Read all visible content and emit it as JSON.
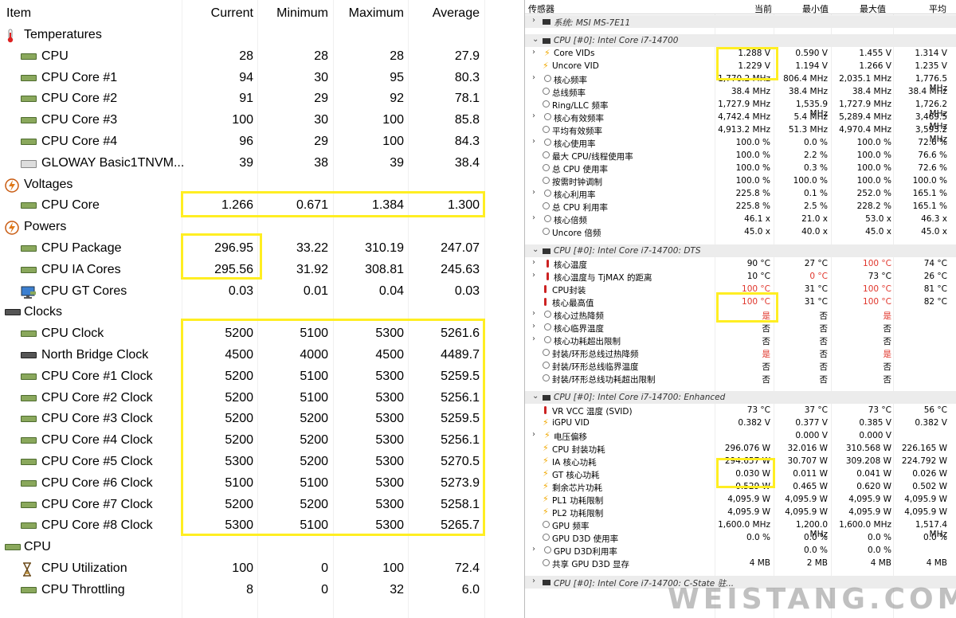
{
  "left": {
    "headers": {
      "item": "Item",
      "current": "Current",
      "minimum": "Minimum",
      "maximum": "Maximum",
      "average": "Average"
    },
    "rows": [
      {
        "kind": "group",
        "icon": "thermometer-icon",
        "name": "Temperatures"
      },
      {
        "kind": "item",
        "icon": "chip",
        "name": "CPU",
        "v": [
          "28",
          "28",
          "28",
          "27.9"
        ]
      },
      {
        "kind": "item",
        "icon": "chip",
        "name": "CPU Core #1",
        "v": [
          "94",
          "30",
          "95",
          "80.3"
        ]
      },
      {
        "kind": "item",
        "icon": "chip",
        "name": "CPU Core #2",
        "v": [
          "91",
          "29",
          "92",
          "78.1"
        ]
      },
      {
        "kind": "item",
        "icon": "chip",
        "name": "CPU Core #3",
        "v": [
          "100",
          "30",
          "100",
          "85.8"
        ]
      },
      {
        "kind": "item",
        "icon": "chip",
        "name": "CPU Core #4",
        "v": [
          "96",
          "29",
          "100",
          "84.3"
        ]
      },
      {
        "kind": "item",
        "icon": "disk",
        "name": "GLOWAY Basic1TNVM...",
        "v": [
          "39",
          "38",
          "39",
          "38.4"
        ]
      },
      {
        "kind": "group",
        "icon": "lightning-icon",
        "name": "Voltages"
      },
      {
        "kind": "item",
        "icon": "chip",
        "name": "CPU Core",
        "v": [
          "1.266",
          "0.671",
          "1.384",
          "1.300"
        ]
      },
      {
        "kind": "group",
        "icon": "lightning-icon",
        "name": "Powers"
      },
      {
        "kind": "item",
        "icon": "chip",
        "name": "CPU Package",
        "v": [
          "296.95",
          "33.22",
          "310.19",
          "247.07"
        ]
      },
      {
        "kind": "item",
        "icon": "chip",
        "name": "CPU IA Cores",
        "v": [
          "295.56",
          "31.92",
          "308.81",
          "245.63"
        ]
      },
      {
        "kind": "item",
        "icon": "monitor",
        "name": "CPU GT Cores",
        "v": [
          "0.03",
          "0.01",
          "0.04",
          "0.03"
        ]
      },
      {
        "kind": "group",
        "icon": "dark-chip",
        "name": "Clocks"
      },
      {
        "kind": "item",
        "icon": "chip",
        "name": "CPU Clock",
        "v": [
          "5200",
          "5100",
          "5300",
          "5261.6"
        ]
      },
      {
        "kind": "item",
        "icon": "dark-chip",
        "name": "North Bridge Clock",
        "v": [
          "4500",
          "4000",
          "4500",
          "4489.7"
        ]
      },
      {
        "kind": "item",
        "icon": "chip",
        "name": "CPU Core #1 Clock",
        "v": [
          "5200",
          "5100",
          "5300",
          "5259.5"
        ]
      },
      {
        "kind": "item",
        "icon": "chip",
        "name": "CPU Core #2 Clock",
        "v": [
          "5200",
          "5100",
          "5300",
          "5256.1"
        ]
      },
      {
        "kind": "item",
        "icon": "chip",
        "name": "CPU Core #3 Clock",
        "v": [
          "5200",
          "5200",
          "5300",
          "5259.5"
        ]
      },
      {
        "kind": "item",
        "icon": "chip",
        "name": "CPU Core #4 Clock",
        "v": [
          "5200",
          "5200",
          "5300",
          "5256.1"
        ]
      },
      {
        "kind": "item",
        "icon": "chip",
        "name": "CPU Core #5 Clock",
        "v": [
          "5300",
          "5200",
          "5300",
          "5270.5"
        ]
      },
      {
        "kind": "item",
        "icon": "chip",
        "name": "CPU Core #6 Clock",
        "v": [
          "5100",
          "5100",
          "5300",
          "5273.9"
        ]
      },
      {
        "kind": "item",
        "icon": "chip",
        "name": "CPU Core #7 Clock",
        "v": [
          "5200",
          "5200",
          "5300",
          "5258.1"
        ]
      },
      {
        "kind": "item",
        "icon": "chip",
        "name": "CPU Core #8 Clock",
        "v": [
          "5300",
          "5100",
          "5300",
          "5265.7"
        ]
      },
      {
        "kind": "group",
        "icon": "chip",
        "name": "CPU"
      },
      {
        "kind": "item",
        "icon": "hourglass-icon",
        "name": "CPU Utilization",
        "v": [
          "100",
          "0",
          "100",
          "72.4"
        ]
      },
      {
        "kind": "item",
        "icon": "chip",
        "name": "CPU Throttling",
        "v": [
          "8",
          "0",
          "32",
          "6.0"
        ]
      }
    ]
  },
  "right": {
    "headers": {
      "sensor": "传感器",
      "current": "当前",
      "min": "最小值",
      "max": "最大值",
      "avg": "平均"
    },
    "sections": [
      {
        "title": "系统: MSI MS-7E11",
        "rows": []
      },
      {
        "title": "CPU [#0]: Intel Core i7-14700",
        "rows": [
          {
            "a": ">",
            "i": "bolt",
            "n": "Core VIDs",
            "v": [
              "1.288 V",
              "0.590 V",
              "1.455 V",
              "1.314 V"
            ]
          },
          {
            "a": "",
            "i": "bolt",
            "n": "Uncore VID",
            "v": [
              "1.229 V",
              "1.194 V",
              "1.266 V",
              "1.235 V"
            ]
          },
          {
            "a": ">",
            "i": "circ",
            "n": "核心频率",
            "v": [
              "1,770.2 MHz",
              "806.4 MHz",
              "2,035.1 MHz",
              "1,776.5 MHz"
            ]
          },
          {
            "a": "",
            "i": "circ",
            "n": "总线频率",
            "v": [
              "38.4 MHz",
              "38.4 MHz",
              "38.4 MHz",
              "38.4 MHz"
            ]
          },
          {
            "a": "",
            "i": "circ",
            "n": "Ring/LLC 频率",
            "v": [
              "1,727.9 MHz",
              "1,535.9 MHz",
              "1,727.9 MHz",
              "1,726.2 MHz"
            ]
          },
          {
            "a": ">",
            "i": "circ",
            "n": "核心有效频率",
            "v": [
              "4,742.4 MHz",
              "5.4 MHz",
              "5,289.4 MHz",
              "3,469.5 MHz"
            ]
          },
          {
            "a": "",
            "i": "circ",
            "n": "平均有效频率",
            "v": [
              "4,913.2 MHz",
              "51.3 MHz",
              "4,970.4 MHz",
              "3,593.2 MHz"
            ]
          },
          {
            "a": ">",
            "i": "circ",
            "n": "核心使用率",
            "v": [
              "100.0 %",
              "0.0 %",
              "100.0 %",
              "72.6 %"
            ]
          },
          {
            "a": "",
            "i": "circ",
            "n": "最大 CPU/线程使用率",
            "v": [
              "100.0 %",
              "2.2 %",
              "100.0 %",
              "76.6 %"
            ]
          },
          {
            "a": "",
            "i": "circ",
            "n": "总 CPU 使用率",
            "v": [
              "100.0 %",
              "0.3 %",
              "100.0 %",
              "72.6 %"
            ]
          },
          {
            "a": "",
            "i": "circ",
            "n": "按需时钟调制",
            "v": [
              "100.0 %",
              "100.0 %",
              "100.0 %",
              "100.0 %"
            ]
          },
          {
            "a": ">",
            "i": "circ",
            "n": "核心利用率",
            "v": [
              "225.8 %",
              "0.1 %",
              "252.0 %",
              "165.1 %"
            ]
          },
          {
            "a": "",
            "i": "circ",
            "n": "总 CPU 利用率",
            "v": [
              "225.8 %",
              "2.5 %",
              "228.2 %",
              "165.1 %"
            ]
          },
          {
            "a": ">",
            "i": "circ",
            "n": "核心倍频",
            "v": [
              "46.1 x",
              "21.0 x",
              "53.0 x",
              "46.3 x"
            ]
          },
          {
            "a": "",
            "i": "circ",
            "n": "Uncore 倍频",
            "v": [
              "45.0 x",
              "40.0 x",
              "45.0 x",
              "45.0 x"
            ]
          }
        ]
      },
      {
        "title": "CPU [#0]: Intel Core i7-14700: DTS",
        "rows": [
          {
            "a": ">",
            "i": "therm",
            "n": "核心温度",
            "v": [
              "90 °C",
              "27 °C",
              "100 °C",
              "74 °C"
            ],
            "red": [
              2
            ]
          },
          {
            "a": ">",
            "i": "therm",
            "n": "核心温度与 TjMAX 的距离",
            "v": [
              "10 °C",
              "0 °C",
              "73 °C",
              "26 °C"
            ],
            "red": [
              1
            ]
          },
          {
            "a": "",
            "i": "therm",
            "n": "CPU封装",
            "v": [
              "100 °C",
              "31 °C",
              "100 °C",
              "81 °C"
            ],
            "red": [
              0,
              2
            ]
          },
          {
            "a": "",
            "i": "therm",
            "n": "核心最高值",
            "v": [
              "100 °C",
              "31 °C",
              "100 °C",
              "82 °C"
            ],
            "red": [
              0,
              2
            ]
          },
          {
            "a": ">",
            "i": "circ",
            "n": "核心过热降频",
            "v": [
              "是",
              "否",
              "是",
              ""
            ],
            "red": [
              0,
              2
            ]
          },
          {
            "a": ">",
            "i": "circ",
            "n": "核心临界温度",
            "v": [
              "否",
              "否",
              "否",
              ""
            ]
          },
          {
            "a": ">",
            "i": "circ",
            "n": "核心功耗超出限制",
            "v": [
              "否",
              "否",
              "否",
              ""
            ]
          },
          {
            "a": "",
            "i": "circ",
            "n": "封装/环形总线过热降频",
            "v": [
              "是",
              "否",
              "是",
              ""
            ],
            "red": [
              0,
              2
            ]
          },
          {
            "a": "",
            "i": "circ",
            "n": "封装/环形总线临界温度",
            "v": [
              "否",
              "否",
              "否",
              ""
            ]
          },
          {
            "a": "",
            "i": "circ",
            "n": "封装/环形总线功耗超出限制",
            "v": [
              "否",
              "否",
              "否",
              ""
            ]
          }
        ]
      },
      {
        "title": "CPU [#0]: Intel Core i7-14700: Enhanced",
        "rows": [
          {
            "a": "",
            "i": "therm",
            "n": "VR VCC 温度 (SVID)",
            "v": [
              "73 °C",
              "37 °C",
              "73 °C",
              "56 °C"
            ]
          },
          {
            "a": "",
            "i": "bolt",
            "n": "iGPU VID",
            "v": [
              "0.382 V",
              "0.377 V",
              "0.385 V",
              "0.382 V"
            ]
          },
          {
            "a": ">",
            "i": "bolt",
            "n": "电压偏移",
            "v": [
              "",
              "0.000 V",
              "0.000 V",
              ""
            ]
          },
          {
            "a": "",
            "i": "bolt",
            "n": "CPU 封装功耗",
            "v": [
              "296.076 W",
              "32.016 W",
              "310.568 W",
              "226.165 W"
            ]
          },
          {
            "a": "",
            "i": "bolt",
            "n": "IA 核心功耗",
            "v": [
              "294.657 W",
              "30.707 W",
              "309.208 W",
              "224.792 W"
            ]
          },
          {
            "a": "",
            "i": "bolt",
            "n": "GT 核心功耗",
            "v": [
              "0.030 W",
              "0.011 W",
              "0.041 W",
              "0.026 W"
            ]
          },
          {
            "a": "",
            "i": "bolt",
            "n": "剩余芯片功耗",
            "v": [
              "0.529 W",
              "0.465 W",
              "0.620 W",
              "0.502 W"
            ]
          },
          {
            "a": "",
            "i": "bolt",
            "n": "PL1 功耗限制",
            "v": [
              "4,095.9 W",
              "4,095.9 W",
              "4,095.9 W",
              "4,095.9 W"
            ]
          },
          {
            "a": "",
            "i": "bolt",
            "n": "PL2 功耗限制",
            "v": [
              "4,095.9 W",
              "4,095.9 W",
              "4,095.9 W",
              "4,095.9 W"
            ]
          },
          {
            "a": "",
            "i": "circ",
            "n": "GPU 频率",
            "v": [
              "1,600.0 MHz",
              "1,200.0 MHz",
              "1,600.0 MHz",
              "1,517.4 MHz"
            ]
          },
          {
            "a": "",
            "i": "circ",
            "n": "GPU D3D 使用率",
            "v": [
              "0.0 %",
              "0.0 %",
              "0.0 %",
              "0.0 %"
            ]
          },
          {
            "a": ">",
            "i": "circ",
            "n": "GPU D3D利用率",
            "v": [
              "",
              "0.0 %",
              "0.0 %",
              ""
            ]
          },
          {
            "a": "",
            "i": "circ",
            "n": "共享 GPU D3D 显存",
            "v": [
              "4 MB",
              "2 MB",
              "4 MB",
              "4 MB"
            ]
          }
        ]
      },
      {
        "title": "CPU [#0]: Intel Core i7-14700: C-State 驻...",
        "rows": []
      }
    ]
  },
  "watermark": "WEISTANG.COM"
}
